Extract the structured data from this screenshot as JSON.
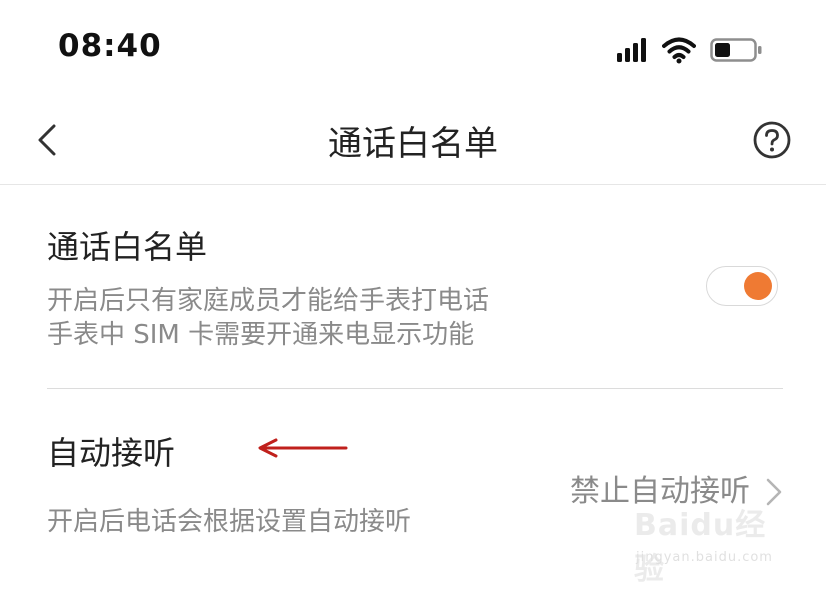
{
  "status_bar": {
    "time": "08:40",
    "icons": [
      "cellular-signal-icon",
      "wifi-icon",
      "battery-icon"
    ]
  },
  "nav": {
    "back_icon": "chevron-left-icon",
    "title": "通话白名单",
    "help_icon": "question-circle-icon"
  },
  "whitelist": {
    "title": "通话白名单",
    "desc_line1": "开启后只有家庭成员才能给手表打电话",
    "desc_line2": "手表中 SIM 卡需要开通来电显示功能",
    "toggle_on": true,
    "toggle_color": "#ef7a33"
  },
  "auto_answer": {
    "title": "自动接听",
    "desc": "开启后电话会根据设置自动接听",
    "value": "禁止自动接听",
    "chevron_icon": "chevron-right-icon"
  },
  "annotation": {
    "arrow_color": "#c0201c"
  },
  "watermark": {
    "text": "Baidu经验",
    "sub": "jingyan.baidu.com"
  }
}
